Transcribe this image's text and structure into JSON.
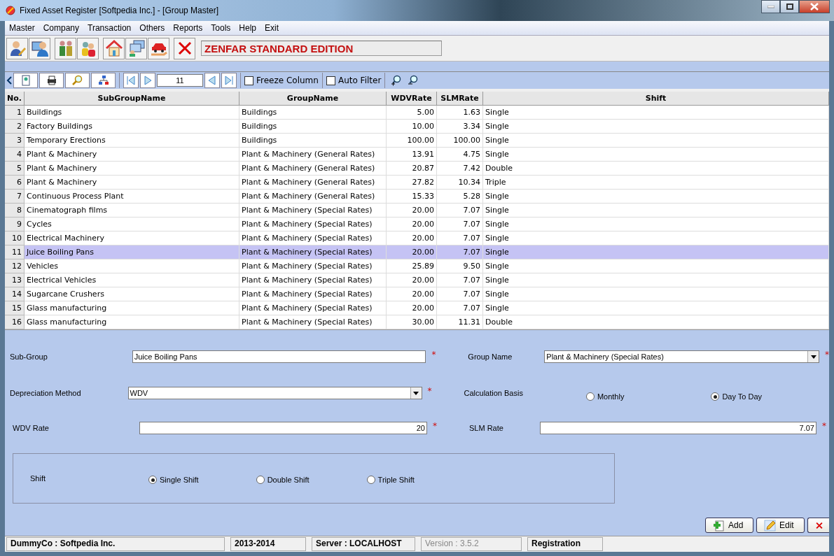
{
  "window": {
    "title": "Fixed Asset Register [Softpedia Inc.] - [Group Master]"
  },
  "menu": [
    "Master",
    "Company",
    "Transaction",
    "Others",
    "Reports",
    "Tools",
    "Help",
    "Exit"
  ],
  "edition_banner": "ZENFAR STANDARD EDITION",
  "grid_toolbar": {
    "record": "11",
    "checkboxes": [
      {
        "label": "Freeze Column",
        "checked": false
      },
      {
        "label": "Auto Filter",
        "checked": false
      }
    ]
  },
  "table": {
    "columns": [
      "No.",
      "SubGroupName",
      "GroupName",
      "WDVRate",
      "SLMRate",
      "Shift"
    ],
    "rows": [
      {
        "cells": [
          "1",
          "Buildings",
          "Buildings",
          "5.00",
          "1.63",
          "Single"
        ],
        "selected": false
      },
      {
        "cells": [
          "2",
          "Factory Buildings",
          "Buildings",
          "10.00",
          "3.34",
          "Single"
        ],
        "selected": false
      },
      {
        "cells": [
          "3",
          "Temporary Erections",
          "Buildings",
          "100.00",
          "100.00",
          "Single"
        ],
        "selected": false
      },
      {
        "cells": [
          "4",
          "Plant & Machinery",
          "Plant & Machinery (General Rates)",
          "13.91",
          "4.75",
          "Single"
        ],
        "selected": false
      },
      {
        "cells": [
          "5",
          "Plant & Machinery",
          "Plant & Machinery (General Rates)",
          "20.87",
          "7.42",
          "Double"
        ],
        "selected": false
      },
      {
        "cells": [
          "6",
          "Plant & Machinery",
          "Plant & Machinery (General Rates)",
          "27.82",
          "10.34",
          "Triple"
        ],
        "selected": false
      },
      {
        "cells": [
          "7",
          "Continuous Process Plant",
          "Plant & Machinery (General Rates)",
          "15.33",
          "5.28",
          "Single"
        ],
        "selected": false
      },
      {
        "cells": [
          "8",
          "Cinematograph films",
          "Plant & Machinery (Special Rates)",
          "20.00",
          "7.07",
          "Single"
        ],
        "selected": false
      },
      {
        "cells": [
          "9",
          "Cycles",
          "Plant & Machinery (Special Rates)",
          "20.00",
          "7.07",
          "Single"
        ],
        "selected": false
      },
      {
        "cells": [
          "10",
          "Electrical Machinery",
          "Plant & Machinery (Special Rates)",
          "20.00",
          "7.07",
          "Single"
        ],
        "selected": false
      },
      {
        "cells": [
          "11",
          "Juice Boiling Pans",
          "Plant & Machinery (Special Rates)",
          "20.00",
          "7.07",
          "Single"
        ],
        "selected": true
      },
      {
        "cells": [
          "12",
          "Vehicles",
          "Plant & Machinery (Special Rates)",
          "25.89",
          "9.50",
          "Single"
        ],
        "selected": false
      },
      {
        "cells": [
          "13",
          "Electrical Vehicles",
          "Plant & Machinery (Special Rates)",
          "20.00",
          "7.07",
          "Single"
        ],
        "selected": false
      },
      {
        "cells": [
          "14",
          "Sugarcane Crushers",
          "Plant & Machinery (Special Rates)",
          "20.00",
          "7.07",
          "Single"
        ],
        "selected": false
      },
      {
        "cells": [
          "15",
          "Glass manufacturing",
          "Plant & Machinery (Special Rates)",
          "20.00",
          "7.07",
          "Single"
        ],
        "selected": false
      },
      {
        "cells": [
          "16",
          "Glass manufacturing",
          "Plant & Machinery (Special Rates)",
          "30.00",
          "11.31",
          "Double"
        ],
        "selected": false
      }
    ]
  },
  "form": {
    "sub_group": {
      "label": "Sub-Group",
      "value": "Juice Boiling Pans",
      "marker": "*"
    },
    "group_name": {
      "label": "Group Name",
      "value": "Plant & Machinery (Special Rates)",
      "marker": "*"
    },
    "depreciation_method": {
      "label": "Depreciation Method",
      "value": "WDV",
      "marker": "*"
    },
    "calculation_basis": {
      "label": "Calculation Basis",
      "options": [
        {
          "label": "Monthly",
          "selected": false
        },
        {
          "label": "Day To Day",
          "selected": true
        }
      ]
    },
    "wdv_rate": {
      "label": "WDV Rate",
      "value": "20",
      "marker": "*"
    },
    "slm_rate": {
      "label": "SLM Rate",
      "value": "7.07",
      "marker": "*"
    },
    "shift": {
      "label": "Shift",
      "options": [
        {
          "label": "Single Shift",
          "selected": true
        },
        {
          "label": "Double Shift",
          "selected": false
        },
        {
          "label": "Triple Shift",
          "selected": false
        }
      ]
    }
  },
  "buttons": [
    {
      "kind": "add",
      "label": "Add"
    },
    {
      "kind": "edit",
      "label": "Edit"
    },
    {
      "kind": "delete"
    }
  ],
  "status_bar": [
    {
      "text": "DummyCo : Softpedia Inc.",
      "disabled": false
    },
    {
      "text": "2013-2014",
      "disabled": false
    },
    {
      "text": "Server : LOCALHOST",
      "disabled": false
    },
    {
      "text": "Version : 3.5.2",
      "disabled": true
    },
    {
      "text": "Registration",
      "disabled": false
    }
  ]
}
